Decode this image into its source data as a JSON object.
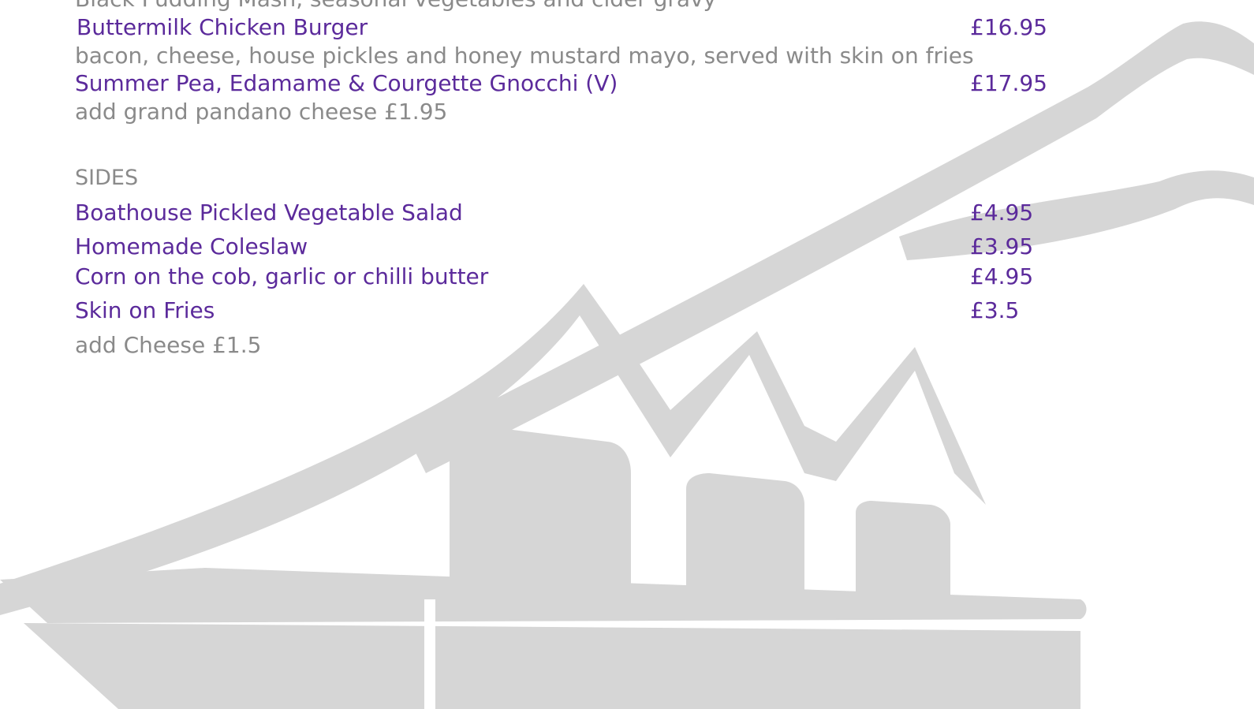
{
  "menu": {
    "prev_description": "Black Pudding Mash, seasonal vegetables and cider gravy",
    "mains": [
      {
        "name": "Buttermilk Chicken Burger",
        "price": "£16.95",
        "description": "bacon, cheese, house pickles and honey mustard mayo, served with skin on fries"
      },
      {
        "name": "Summer Pea, Edamame & Courgette Gnocchi (V)",
        "price": "£17.95",
        "description": "add grand pandano cheese £1.95"
      }
    ],
    "sides_heading": "SIDES",
    "sides": [
      {
        "name": "Boathouse Pickled Vegetable Salad",
        "price": "£4.95"
      },
      {
        "name": "Homemade Coleslaw",
        "price": "£3.95"
      },
      {
        "name": "Corn on the cob, garlic or chilli butter",
        "price": "£4.95"
      },
      {
        "name": "Skin on Fries",
        "price": "£3.5"
      }
    ],
    "sides_addon": "add Cheese £1.5"
  },
  "colors": {
    "item_name": "#5b2a9b",
    "description": "#8a8a8a",
    "watermark": "#d4d4d4"
  },
  "icons": {
    "watermark": "boathouse-logo-watermark"
  }
}
